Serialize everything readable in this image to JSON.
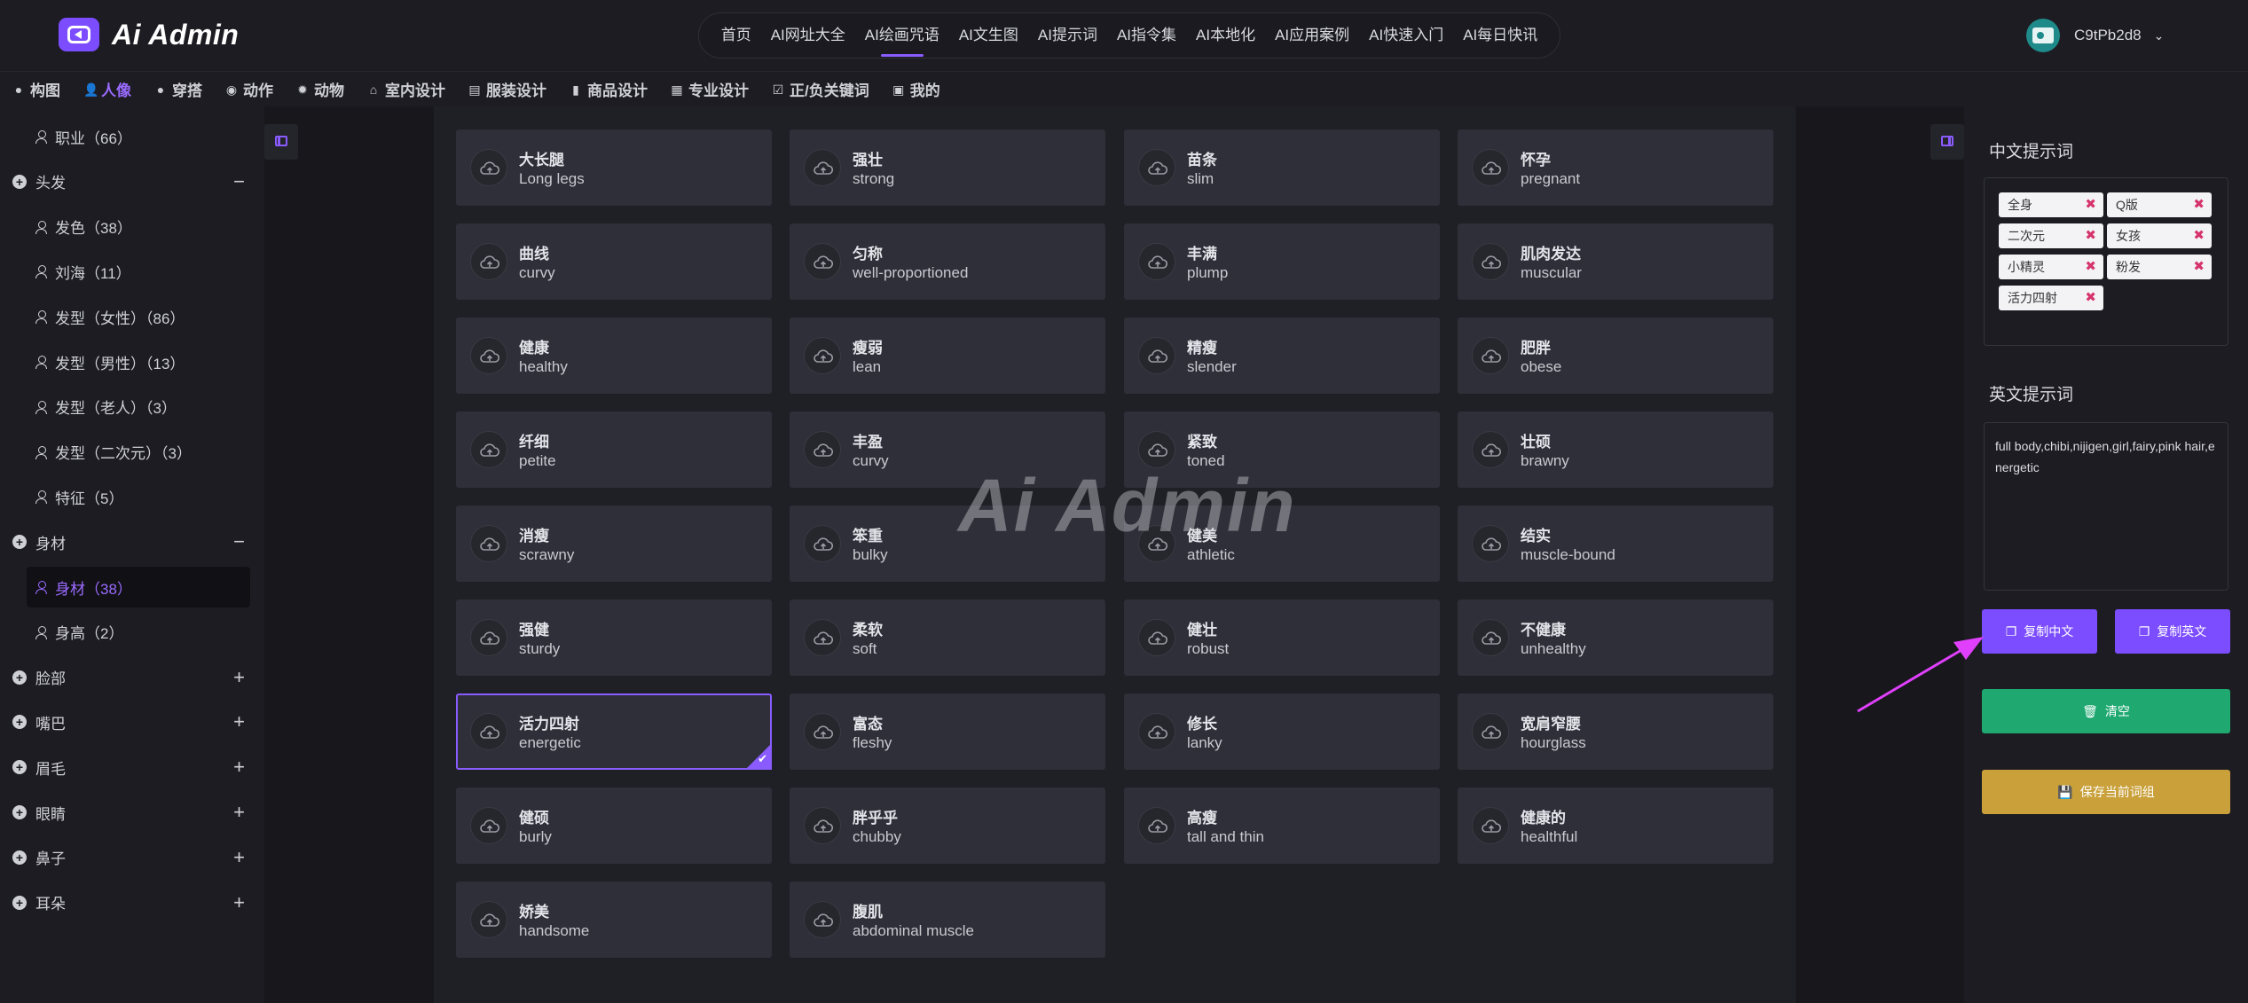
{
  "brand": {
    "name": "Ai Admin"
  },
  "nav": {
    "items": [
      "首页",
      "AI网址大全",
      "AI绘画咒语",
      "AI文生图",
      "AI提示词",
      "AI指令集",
      "AI本地化",
      "AI应用案例",
      "AI快速入门",
      "AI每日快讯"
    ],
    "active_index": 2
  },
  "user": {
    "name": "C9tPb2d8"
  },
  "categories": {
    "items": [
      {
        "label": "构图",
        "icon": "circle-icon"
      },
      {
        "label": "人像",
        "icon": "person-icon",
        "active": true
      },
      {
        "label": "穿搭",
        "icon": "chat-icon"
      },
      {
        "label": "动作",
        "icon": "compass-icon"
      },
      {
        "label": "动物",
        "icon": "bug-icon"
      },
      {
        "label": "室内设计",
        "icon": "home-icon"
      },
      {
        "label": "服装设计",
        "icon": "archive-icon"
      },
      {
        "label": "商品设计",
        "icon": "bookmark-icon"
      },
      {
        "label": "专业设计",
        "icon": "grid-icon"
      },
      {
        "label": "正/负关键词",
        "icon": "checkbox-icon"
      },
      {
        "label": "我的",
        "icon": "save-icon"
      }
    ]
  },
  "sidebar": {
    "rows": [
      {
        "type": "item",
        "label": "职业（66）"
      },
      {
        "type": "group",
        "label": "头发",
        "toggle": "−"
      },
      {
        "type": "item",
        "label": "发色（38）"
      },
      {
        "type": "item",
        "label": "刘海（11）"
      },
      {
        "type": "item",
        "label": "发型（女性）（86）"
      },
      {
        "type": "item",
        "label": "发型（男性）（13）"
      },
      {
        "type": "item",
        "label": "发型（老人）（3）"
      },
      {
        "type": "item",
        "label": "发型（二次元）（3）"
      },
      {
        "type": "item",
        "label": "特征（5）"
      },
      {
        "type": "group",
        "label": "身材",
        "toggle": "−"
      },
      {
        "type": "item",
        "label": "身材（38）",
        "active": true
      },
      {
        "type": "item",
        "label": "身高（2）"
      },
      {
        "type": "group",
        "label": "脸部",
        "toggle": "+"
      },
      {
        "type": "group",
        "label": "嘴巴",
        "toggle": "+"
      },
      {
        "type": "group",
        "label": "眉毛",
        "toggle": "+"
      },
      {
        "type": "group",
        "label": "眼睛",
        "toggle": "+"
      },
      {
        "type": "group",
        "label": "鼻子",
        "toggle": "+"
      },
      {
        "type": "group",
        "label": "耳朵",
        "toggle": "+"
      }
    ]
  },
  "keywords": [
    {
      "zh": "大长腿",
      "en": "Long legs"
    },
    {
      "zh": "强壮",
      "en": "strong"
    },
    {
      "zh": "苗条",
      "en": "slim"
    },
    {
      "zh": "怀孕",
      "en": "pregnant"
    },
    {
      "zh": "曲线",
      "en": "curvy"
    },
    {
      "zh": "匀称",
      "en": "well-proportioned"
    },
    {
      "zh": "丰满",
      "en": "plump"
    },
    {
      "zh": "肌肉发达",
      "en": "muscular"
    },
    {
      "zh": "健康",
      "en": "healthy"
    },
    {
      "zh": "瘦弱",
      "en": "lean"
    },
    {
      "zh": "精瘦",
      "en": "slender"
    },
    {
      "zh": "肥胖",
      "en": "obese"
    },
    {
      "zh": "纤细",
      "en": "petite"
    },
    {
      "zh": "丰盈",
      "en": "curvy"
    },
    {
      "zh": "紧致",
      "en": "toned"
    },
    {
      "zh": "壮硕",
      "en": "brawny"
    },
    {
      "zh": "消瘦",
      "en": "scrawny"
    },
    {
      "zh": "笨重",
      "en": "bulky"
    },
    {
      "zh": "健美",
      "en": "athletic"
    },
    {
      "zh": "结实",
      "en": "muscle-bound"
    },
    {
      "zh": "强健",
      "en": "sturdy"
    },
    {
      "zh": "柔软",
      "en": "soft"
    },
    {
      "zh": "健壮",
      "en": "robust"
    },
    {
      "zh": "不健康",
      "en": "unhealthy"
    },
    {
      "zh": "活力四射",
      "en": "energetic",
      "selected": true
    },
    {
      "zh": "富态",
      "en": "fleshy"
    },
    {
      "zh": "修长",
      "en": "lanky"
    },
    {
      "zh": "宽肩窄腰",
      "en": "hourglass"
    },
    {
      "zh": "健硕",
      "en": "burly"
    },
    {
      "zh": "胖乎乎",
      "en": "chubby"
    },
    {
      "zh": "高瘦",
      "en": "tall and thin"
    },
    {
      "zh": "健康的",
      "en": "healthful"
    },
    {
      "zh": "娇美",
      "en": "handsome"
    },
    {
      "zh": "腹肌",
      "en": "abdominal muscle"
    }
  ],
  "watermark": "Ai Admin",
  "right_panel": {
    "zh_title": "中文提示词",
    "zh_tags": [
      "全身",
      "Q版",
      "二次元",
      "女孩",
      "小精灵",
      "粉发",
      "活力四射"
    ],
    "tag_remove_glyph": "✖",
    "en_title": "英文提示词",
    "en_text": "full body,chibi,nijigen,girl,fairy,pink hair,energetic",
    "copy_zh": "复制中文",
    "copy_en": "复制英文",
    "clear": "清空",
    "save": "保存当前词组"
  },
  "colors": {
    "accent": "#8a5cff",
    "clear": "#1fa971",
    "save": "#c9a03a",
    "arrow": "#e040fb"
  }
}
